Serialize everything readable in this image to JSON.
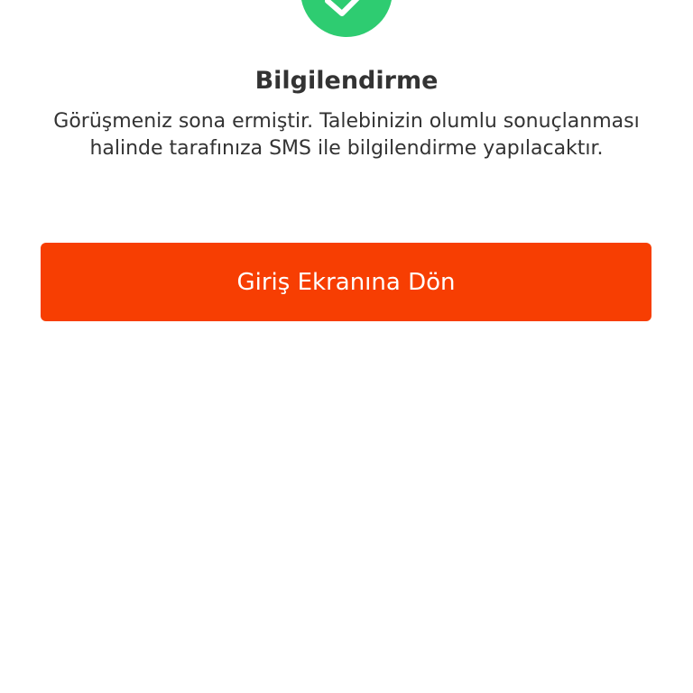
{
  "status_icon": {
    "name": "checkmark-icon",
    "color": "#2ecc71"
  },
  "dialog": {
    "title": "Bilgilendirme",
    "message": "Görüşmeniz sona ermiştir. Talebinizin olumlu sonuçlanması halinde tarafınıza SMS ile bilgilendirme yapılacaktır.",
    "button_label": "Giriş Ekranına Dön",
    "button_color": "#f73e02"
  }
}
